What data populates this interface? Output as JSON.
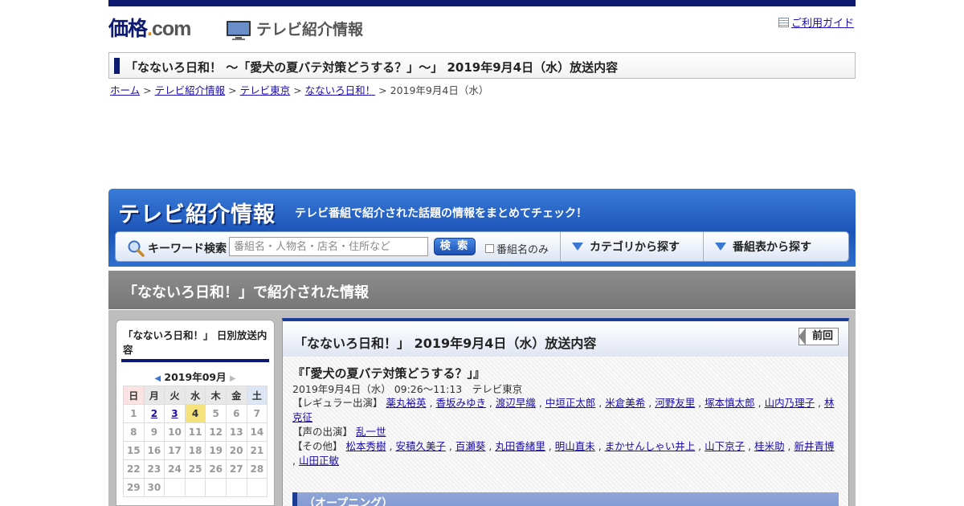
{
  "header": {
    "logo_main": "価格",
    "logo_dot": ".",
    "logo_com": "com",
    "section_title": "テレビ紹介情報",
    "guide_link": "ご利用ガイド"
  },
  "page_heading": "「なないろ日和！ ～「愛犬の夏バテ対策どうする？」～」 2019年9月4日（水）放送内容",
  "breadcrumb": {
    "items": [
      "ホーム",
      "テレビ紹介情報",
      "テレビ東京",
      "なないろ日和！"
    ],
    "current": "2019年9月4日（水）",
    "separator": ">"
  },
  "banner": {
    "title": "テレビ紹介情報",
    "subtitle": "テレビ番組で紹介された話題の情報をまとめてチェック！",
    "search_label": "キーワード検索",
    "search_placeholder": "番組名・人物名・店名・住所など",
    "search_button": "検 索",
    "checkbox_label": "番組名のみ",
    "nav_category": "カテゴリから探す",
    "nav_schedule": "番組表から探す"
  },
  "section_band": "「なないろ日和！」で紹介された情報",
  "sidebar": {
    "title": "「なないろ日和！」 日別放送内容",
    "month": "2019年09月",
    "weekdays": [
      "日",
      "月",
      "火",
      "水",
      "木",
      "金",
      "土"
    ],
    "weeks": [
      [
        "1",
        "2",
        "3",
        "4",
        "5",
        "6",
        "7"
      ],
      [
        "8",
        "9",
        "10",
        "11",
        "12",
        "13",
        "14"
      ],
      [
        "15",
        "16",
        "17",
        "18",
        "19",
        "20",
        "21"
      ],
      [
        "22",
        "23",
        "24",
        "25",
        "26",
        "27",
        "28"
      ],
      [
        "29",
        "30",
        "",
        "",
        "",
        "",
        ""
      ]
    ],
    "linked_days": [
      "2",
      "3"
    ],
    "today": "4"
  },
  "main": {
    "heading": "「なないろ日和！」 2019年9月4日（水）放送内容",
    "prev_button": "前回",
    "episode_title": "『「愛犬の夏バテ対策どうする？」』",
    "meta": "2019年9月4日（水） 09:26～11:13　テレビ東京",
    "regular_label": "【レギュラー出演】",
    "regular_cast": [
      "薬丸裕英",
      "香坂みゆき",
      "渡辺早織",
      "中垣正太郎",
      "米倉美希",
      "河野友里",
      "塚本慎太郎",
      "山内乃理子",
      "林克征"
    ],
    "voice_label": "【声の出演】",
    "voice_cast": [
      "乱一世"
    ],
    "other_label": "【その他】",
    "other_cast": [
      "松本秀樹",
      "安積久美子",
      "百瀬葵",
      "丸田香緒里",
      "明山直未",
      "まかせんしゃい井上",
      "山下京子",
      "桂米助",
      "新井青博",
      "山田正敏"
    ],
    "opening_section": "（オープニング）"
  },
  "colors": {
    "navy": "#0e1a70",
    "banner_blue": "#1c55b8",
    "link": "#1a0dab",
    "today_highlight": "#f6e27a"
  }
}
